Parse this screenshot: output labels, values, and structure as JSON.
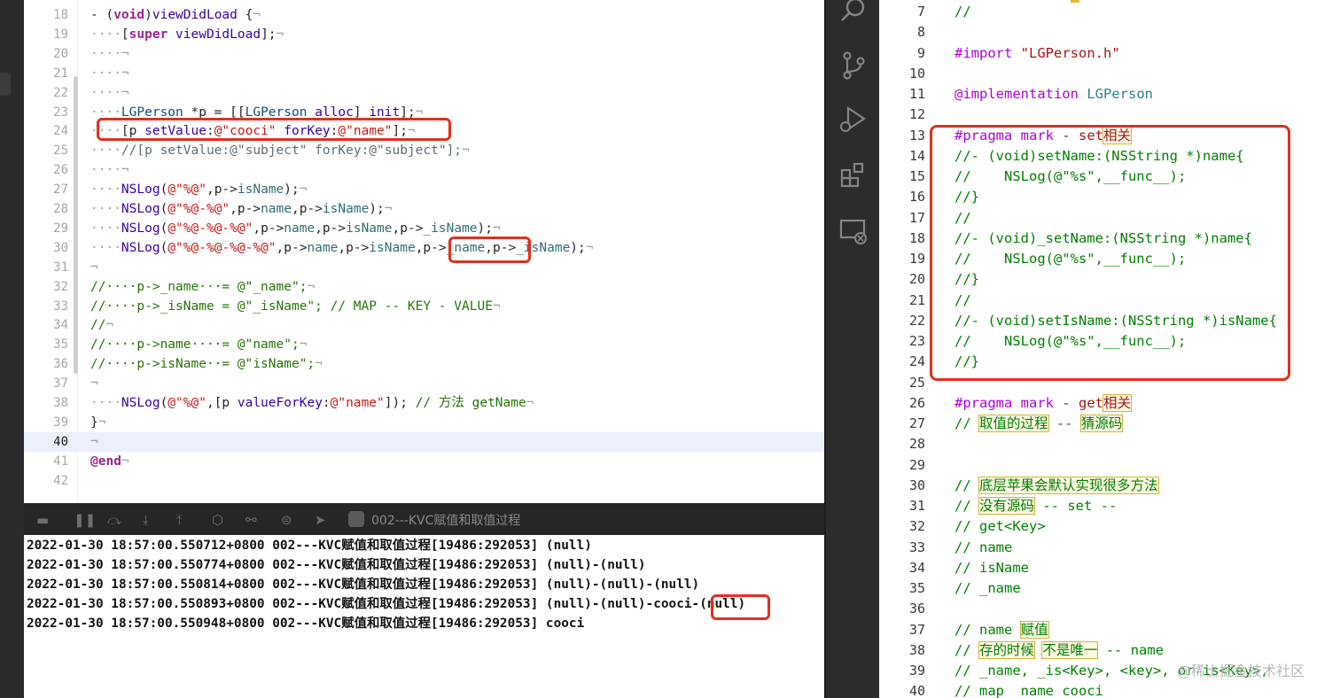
{
  "xcode": {
    "editor_lines": [
      {
        "n": "18",
        "html": "<span class='xd'></span>- (<span class='xk'>void</span>)<span class='xf'>viewDidLoad</span> {<span class='xd'>¬</span>"
      },
      {
        "n": "19",
        "html": "<span class='xd'>····</span>[<span class='xk'>super</span> <span class='xf'>viewDidLoad</span>];<span class='xd'>¬</span>"
      },
      {
        "n": "20",
        "html": "<span class='xd'>····¬</span>"
      },
      {
        "n": "21",
        "html": "<span class='xd'>····¬</span>"
      },
      {
        "n": "22",
        "html": "<span class='xd'>····¬</span>"
      },
      {
        "n": "23",
        "html": "<span class='xd'>····</span><span class='xt'>LGPerson</span> *p = [[<span class='xt'>LGPerson</span> <span class='xf'>alloc</span>] <span class='xf'>init</span>];<span class='xd'>¬</span>"
      },
      {
        "n": "24",
        "html": "<span class='xd'>····</span>[p <span class='xf'>setValue</span>:<span class='xs'>@\"cooci\"</span> <span class='xf'>forKey</span>:<span class='xs'>@\"name\"</span>];<span class='xd'>¬</span>"
      },
      {
        "n": "25",
        "html": "<span class='xd'>····</span><span class='xc'>//[p setValue:@\"subject\" forKey:@\"subject\"];</span><span class='xd'>¬</span>"
      },
      {
        "n": "26",
        "html": "<span class='xd'>····¬</span>"
      },
      {
        "n": "27",
        "html": "<span class='xd'>····</span><span class='xf'>NSLog</span>(<span class='xs'>@\"%@\"</span>,p-&gt;<span class='xp'>isName</span>);<span class='xd'>¬</span>"
      },
      {
        "n": "28",
        "html": "<span class='xd'>····</span><span class='xf'>NSLog</span>(<span class='xs'>@\"%@-%@\"</span>,p-&gt;<span class='xp'>name</span>,p-&gt;<span class='xp'>isName</span>);<span class='xd'>¬</span>"
      },
      {
        "n": "29",
        "html": "<span class='xd'>····</span><span class='xf'>NSLog</span>(<span class='xs'>@\"%@-%@-%@\"</span>,p-&gt;<span class='xp'>name</span>,p-&gt;<span class='xp'>isName</span>,p-&gt;<span class='xp'>_isName</span>);<span class='xd'>¬</span>"
      },
      {
        "n": "30",
        "html": "<span class='xd'>····</span><span class='xf'>NSLog</span>(<span class='xs'>@\"%@-%@-%@-%@\"</span>,p-&gt;<span class='xp'>name</span>,p-&gt;<span class='xp'>isName</span>,p-&gt;<span class='xp'>_name</span>,p-&gt;<span class='xp'>_isName</span>);<span class='xd'>¬</span>"
      },
      {
        "n": "31",
        "html": "<span class='xd'>¬</span>"
      },
      {
        "n": "32",
        "html": "<span class='xcm'>//····p-&gt;_name···= @\"_name\";</span><span class='xd'>¬</span>"
      },
      {
        "n": "33",
        "html": "<span class='xcm'>//····p-&gt;_isName = @\"_isName\"; // MAP -- KEY - VALUE</span><span class='xd'>¬</span>"
      },
      {
        "n": "34",
        "html": "<span class='xcm'>//</span><span class='xd'>¬</span>"
      },
      {
        "n": "35",
        "html": "<span class='xcm'>//····p-&gt;name····= @\"name\";</span><span class='xd'>¬</span>"
      },
      {
        "n": "36",
        "html": "<span class='xcm'>//····p-&gt;isName··= @\"isName\";</span><span class='xd'>¬</span>"
      },
      {
        "n": "37",
        "html": "<span class='xd'>¬</span>"
      },
      {
        "n": "38",
        "html": "<span class='xd'>····</span><span class='xf'>NSLog</span>(<span class='xs'>@\"%@\"</span>,[p <span class='xf'>valueForKey</span>:<span class='xs'>@\"name\"</span>]); <span class='xcm'>// 方法 getName</span><span class='xd'>¬</span>"
      },
      {
        "n": "39",
        "html": "}<span class='xd'>¬</span>"
      },
      {
        "n": "40",
        "html": "<span class='xd'>¬</span>"
      },
      {
        "n": "41",
        "html": "<span class='xk'>@end</span><span class='xd'>¬</span>"
      },
      {
        "n": "42",
        "html": ""
      }
    ],
    "current_line": "40",
    "debug_scheme": "002---KVC赋值和取值过程",
    "console_lines": [
      "2022-01-30 18:57:00.550712+0800 002---KVC赋值和取值过程[19486:292053] (null)",
      "2022-01-30 18:57:00.550774+0800 002---KVC赋值和取值过程[19486:292053] (null)-(null)",
      "2022-01-30 18:57:00.550814+0800 002---KVC赋值和取值过程[19486:292053] (null)-(null)-(null)",
      "2022-01-30 18:57:00.550893+0800 002---KVC赋值和取值过程[19486:292053] (null)-(null)-cooci-(null)",
      "2022-01-30 18:57:00.550948+0800 002---KVC赋值和取值过程[19486:292053] cooci"
    ]
  },
  "vscode": {
    "lines": [
      {
        "n": "7",
        "html": "<span class='vs-cm'>//</span>"
      },
      {
        "n": "8",
        "html": ""
      },
      {
        "n": "9",
        "html": "<span class='vk'>#import</span> <span class='vs-str'>\"LGPerson.h\"</span>"
      },
      {
        "n": "10",
        "html": ""
      },
      {
        "n": "11",
        "html": "<span class='vk'>@implementation</span> <span class='vs-cl'>LGPerson</span>"
      },
      {
        "n": "12",
        "html": ""
      },
      {
        "n": "13",
        "html": "<span class='vk'>#pragma</span> <span class='vk'>mark</span> <span class='vs-str'>- set<span class='cjk'>相关</span></span>"
      },
      {
        "n": "14",
        "html": "//- (void)setName:(NSString *)name{"
      },
      {
        "n": "15",
        "html": "//    NSLog(@\"%s\",__func__);"
      },
      {
        "n": "16",
        "html": "//}"
      },
      {
        "n": "17",
        "html": "//"
      },
      {
        "n": "18",
        "html": "//- (void)_setName:(NSString *)name{"
      },
      {
        "n": "19",
        "html": "//    NSLog(@\"%s\",__func__);"
      },
      {
        "n": "20",
        "html": "//}"
      },
      {
        "n": "21",
        "html": "//"
      },
      {
        "n": "22",
        "html": "//- (void)setIsName:(NSString *)isName{"
      },
      {
        "n": "23",
        "html": "//    NSLog(@\"%s\",__func__);"
      },
      {
        "n": "24",
        "html": "//}"
      },
      {
        "n": "25",
        "html": ""
      },
      {
        "n": "26",
        "html": "<span class='vk'>#pragma</span> <span class='vk'>mark</span> <span class='vs-str'>- get<span class='cjk'>相关</span></span>"
      },
      {
        "n": "27",
        "html": "// <span class='cjk'>取值的过程</span> -- <span class='cjk'>猜源码</span>"
      },
      {
        "n": "28",
        "html": ""
      },
      {
        "n": "29",
        "html": ""
      },
      {
        "n": "30",
        "html": "// <span class='cjk'>底层苹果会默认实现很多方法</span>"
      },
      {
        "n": "31",
        "html": "// <span class='cjk'>没有源码</span> -- set --"
      },
      {
        "n": "32",
        "html": "// get&lt;Key&gt;"
      },
      {
        "n": "33",
        "html": "// name"
      },
      {
        "n": "34",
        "html": "// isName"
      },
      {
        "n": "35",
        "html": "// _name"
      },
      {
        "n": "36",
        "html": ""
      },
      {
        "n": "37",
        "html": "// name <span class='cjk'>赋值</span>"
      },
      {
        "n": "38",
        "html": "// <span class='cjk'>存的时候</span> <span class='cjk'>不是唯一</span> -- name"
      },
      {
        "n": "39",
        "html": "// _name, _is&lt;Key&gt;, &lt;key&gt;, or is&lt;Key&gt;,"
      },
      {
        "n": "40",
        "html": "// map _name cooci"
      }
    ],
    "watermark": "@稀土掘金技术社区"
  },
  "activity_icons": [
    "search-icon",
    "source-control-icon",
    "run-debug-icon",
    "extensions-icon",
    "remote-explorer-icon"
  ]
}
